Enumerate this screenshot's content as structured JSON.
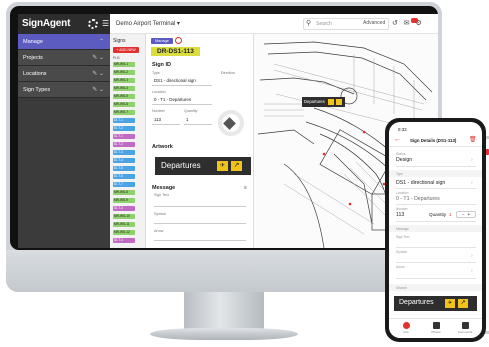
{
  "app": {
    "brand": "SignAgent",
    "project": "Demo Airport Terminal",
    "search_placeholder": "Search",
    "advanced_label": "Advanced"
  },
  "nav": {
    "manage_label": "Manage",
    "items": [
      {
        "label": "Projects"
      },
      {
        "label": "Locations"
      },
      {
        "label": "Sign Types"
      }
    ]
  },
  "signs_list": {
    "title": "Signs",
    "add_button": "+ ADD NEW",
    "subtitle": "PLB",
    "tags": [
      {
        "text": "MR-WS-1",
        "color": "g"
      },
      {
        "text": "MR-WS-2",
        "color": "g"
      },
      {
        "text": "MR-WS-3",
        "color": "g"
      },
      {
        "text": "MR-WS-4",
        "color": "g"
      },
      {
        "text": "MR-WS-5",
        "color": "g"
      },
      {
        "text": "MR-WS-6",
        "color": "g"
      },
      {
        "text": "MR-WS-7",
        "color": "g"
      },
      {
        "text": "DI-T-1",
        "color": "b"
      },
      {
        "text": "DI-T-2",
        "color": "b"
      },
      {
        "text": "ID-T-1",
        "color": "p"
      },
      {
        "text": "ID-T-2",
        "color": "p"
      },
      {
        "text": "DI-T-3",
        "color": "b"
      },
      {
        "text": "DI-T-4",
        "color": "b"
      },
      {
        "text": "DI-T-5",
        "color": "b"
      },
      {
        "text": "DI-T-6",
        "color": "b"
      },
      {
        "text": "DI-T-7",
        "color": "b"
      },
      {
        "text": "MR-WS-8",
        "color": "g"
      },
      {
        "text": "MR-WS-9",
        "color": "g"
      },
      {
        "text": "ID-T-3",
        "color": "p"
      },
      {
        "text": "MR-WS-10",
        "color": "g"
      },
      {
        "text": "MR-WS-11",
        "color": "g"
      },
      {
        "text": "MR-WS-12",
        "color": "g"
      },
      {
        "text": "ID-T-4",
        "color": "p"
      }
    ]
  },
  "detail": {
    "manage_chip": "Manage",
    "sign_code": "DR-DS1-113",
    "sign_id_title": "Sign ID",
    "type_label": "Type",
    "type_value": "DS1 - directional sign",
    "direction_label": "Direction",
    "location_label": "Location",
    "location_value": "0 - T1 - Departures",
    "number_label": "Number",
    "number_value": "113",
    "quantity_label": "Quantity",
    "quantity_value": "1",
    "artwork_title": "Artwork",
    "artwork_text": "Departures",
    "message_title": "Message",
    "sign_text_label": "Sign Text",
    "symbol_label": "Symbol",
    "arrow_label": "Arrow"
  },
  "map": {
    "callout_text": "Departures"
  },
  "phone": {
    "time": "9:32",
    "title": "Sign Details  (DS1-113)",
    "status_label": "Status",
    "status_value": "Design",
    "type_section": "Type",
    "type_value": "DS1 - directional sign",
    "location_label": "Location",
    "location_value": "0 - T1 - Departures",
    "number_label": "Number",
    "number_value": "113",
    "quantity_label": "Quantity",
    "quantity_value": "1",
    "message_section": "Message",
    "sign_text_label": "Sign Text",
    "symbol_label": "Symbol",
    "arrow_label": "Arrow",
    "artwork_section": "Artwork",
    "artwork_text": "Departures",
    "tabs": [
      {
        "label": "Info",
        "color": "#e03030"
      },
      {
        "label": "Photos",
        "color": "#333333"
      },
      {
        "label": "Comments",
        "color": "#333333"
      }
    ]
  },
  "colors": {
    "accent": "#5b5bc0",
    "danger": "#e03030",
    "sign_yellow": "#f2c31b",
    "code_yellow": "#d9dd3f"
  }
}
